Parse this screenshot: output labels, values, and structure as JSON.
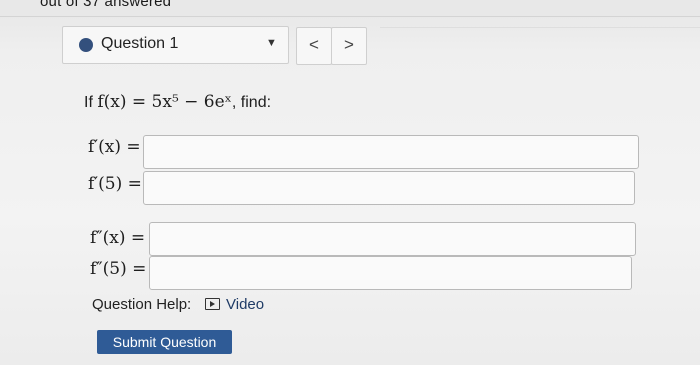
{
  "header": {
    "partial_text": "out of 37 answered"
  },
  "question_nav": {
    "current_label": "Question 1",
    "prev_symbol": "<",
    "next_symbol": ">"
  },
  "problem": {
    "intro": "If",
    "equation": "f(x) = 5x⁵ − 6eˣ",
    "suffix": ", find:"
  },
  "fields": [
    {
      "label": "f′(x) =",
      "value": ""
    },
    {
      "label": "f′(5) =",
      "value": ""
    },
    {
      "label": "f″(x) =",
      "value": ""
    },
    {
      "label": "f″(5) =",
      "value": ""
    }
  ],
  "help": {
    "label": "Question Help:",
    "video_label": "Video"
  },
  "submit_label": "Submit Question",
  "colors": {
    "accent": "#2f5b96",
    "dot": "#33507d",
    "video_link": "#1f3b66"
  }
}
